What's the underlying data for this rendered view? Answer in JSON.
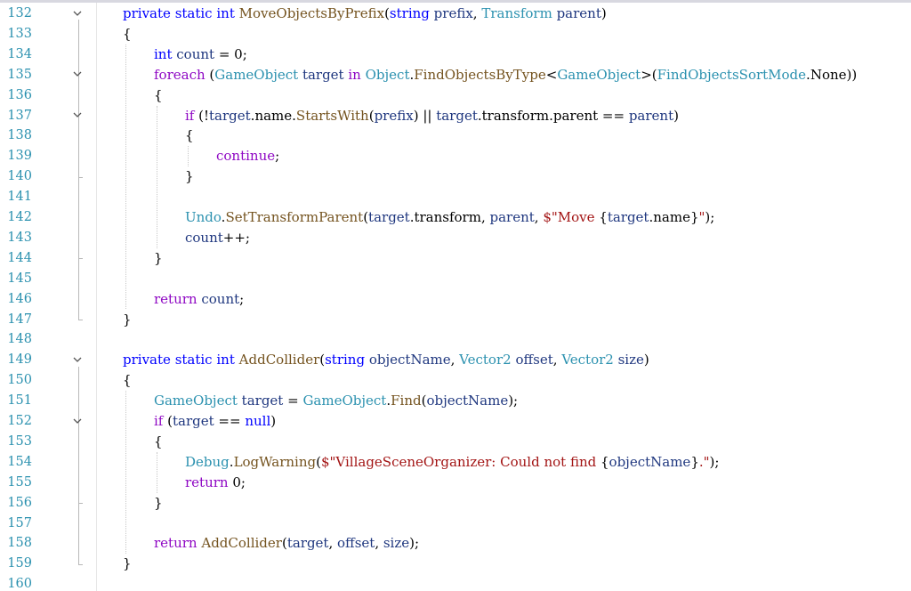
{
  "editor": {
    "lines": [
      {
        "n": "132",
        "fold": true,
        "indent": 0,
        "tokens": [
          [
            "kw",
            "private"
          ],
          [
            "pl",
            " "
          ],
          [
            "kw",
            "static"
          ],
          [
            "pl",
            " "
          ],
          [
            "kw",
            "int"
          ],
          [
            "pl",
            " "
          ],
          [
            "fn",
            "MoveObjectsByPrefix"
          ],
          [
            "pl",
            "("
          ],
          [
            "kw",
            "string"
          ],
          [
            "pl",
            " "
          ],
          [
            "pr",
            "prefix"
          ],
          [
            "pl",
            ", "
          ],
          [
            "ty",
            "Transform"
          ],
          [
            "pl",
            " "
          ],
          [
            "pr",
            "parent"
          ],
          [
            "pl",
            ")"
          ]
        ]
      },
      {
        "n": "133",
        "fold": false,
        "indent": 0,
        "tokens": [
          [
            "pl",
            "{"
          ]
        ]
      },
      {
        "n": "134",
        "fold": false,
        "indent": 1,
        "tokens": [
          [
            "kw",
            "int"
          ],
          [
            "pl",
            " "
          ],
          [
            "pr",
            "count"
          ],
          [
            "pl",
            " = 0;"
          ]
        ]
      },
      {
        "n": "135",
        "fold": true,
        "indent": 1,
        "tokens": [
          [
            "fl",
            "foreach"
          ],
          [
            "pl",
            " ("
          ],
          [
            "ty",
            "GameObject"
          ],
          [
            "pl",
            " "
          ],
          [
            "pr",
            "target"
          ],
          [
            "pl",
            " "
          ],
          [
            "fl",
            "in"
          ],
          [
            "pl",
            " "
          ],
          [
            "ty",
            "Object"
          ],
          [
            "pl",
            "."
          ],
          [
            "fn",
            "FindObjectsByType"
          ],
          [
            "pl",
            "<"
          ],
          [
            "ty",
            "GameObject"
          ],
          [
            "pl",
            ">("
          ],
          [
            "ty",
            "FindObjectsSortMode"
          ],
          [
            "pl",
            ".None))"
          ]
        ]
      },
      {
        "n": "136",
        "fold": false,
        "indent": 1,
        "tokens": [
          [
            "pl",
            "{"
          ]
        ]
      },
      {
        "n": "137",
        "fold": true,
        "indent": 2,
        "tokens": [
          [
            "fl",
            "if"
          ],
          [
            "pl",
            " (!"
          ],
          [
            "pr",
            "target"
          ],
          [
            "pl",
            ".name."
          ],
          [
            "fn",
            "StartsWith"
          ],
          [
            "pl",
            "("
          ],
          [
            "pr",
            "prefix"
          ],
          [
            "pl",
            ") || "
          ],
          [
            "pr",
            "target"
          ],
          [
            "pl",
            ".transform.parent == "
          ],
          [
            "pr",
            "parent"
          ],
          [
            "pl",
            ")"
          ]
        ]
      },
      {
        "n": "138",
        "fold": false,
        "indent": 2,
        "tokens": [
          [
            "pl",
            "{"
          ]
        ]
      },
      {
        "n": "139",
        "fold": false,
        "indent": 3,
        "tokens": [
          [
            "fl",
            "continue"
          ],
          [
            "pl",
            ";"
          ]
        ]
      },
      {
        "n": "140",
        "fold": false,
        "indent": 2,
        "tokens": [
          [
            "pl",
            "}"
          ]
        ]
      },
      {
        "n": "141",
        "fold": false,
        "indent": 2,
        "tokens": []
      },
      {
        "n": "142",
        "fold": false,
        "indent": 2,
        "tokens": [
          [
            "ty",
            "Undo"
          ],
          [
            "pl",
            "."
          ],
          [
            "fn",
            "SetTransformParent"
          ],
          [
            "pl",
            "("
          ],
          [
            "pr",
            "target"
          ],
          [
            "pl",
            ".transform, "
          ],
          [
            "pr",
            "parent"
          ],
          [
            "pl",
            ", "
          ],
          [
            "st",
            "$\"Move "
          ],
          [
            "pl",
            "{"
          ],
          [
            "pr",
            "target"
          ],
          [
            "pl",
            ".name}"
          ],
          [
            "st",
            "\""
          ],
          [
            "pl",
            ");"
          ]
        ]
      },
      {
        "n": "143",
        "fold": false,
        "indent": 2,
        "tokens": [
          [
            "pr",
            "count"
          ],
          [
            "pl",
            "++;"
          ]
        ]
      },
      {
        "n": "144",
        "fold": false,
        "indent": 1,
        "tokens": [
          [
            "pl",
            "}"
          ]
        ]
      },
      {
        "n": "145",
        "fold": false,
        "indent": 1,
        "tokens": []
      },
      {
        "n": "146",
        "fold": false,
        "indent": 1,
        "tokens": [
          [
            "fl",
            "return"
          ],
          [
            "pl",
            " "
          ],
          [
            "pr",
            "count"
          ],
          [
            "pl",
            ";"
          ]
        ]
      },
      {
        "n": "147",
        "fold": false,
        "indent": 0,
        "tokens": [
          [
            "pl",
            "}"
          ]
        ]
      },
      {
        "n": "148",
        "fold": false,
        "indent": 0,
        "tokens": []
      },
      {
        "n": "149",
        "fold": true,
        "indent": 0,
        "tokens": [
          [
            "kw",
            "private"
          ],
          [
            "pl",
            " "
          ],
          [
            "kw",
            "static"
          ],
          [
            "pl",
            " "
          ],
          [
            "kw",
            "int"
          ],
          [
            "pl",
            " "
          ],
          [
            "fn",
            "AddCollider"
          ],
          [
            "pl",
            "("
          ],
          [
            "kw",
            "string"
          ],
          [
            "pl",
            " "
          ],
          [
            "pr",
            "objectName"
          ],
          [
            "pl",
            ", "
          ],
          [
            "ty",
            "Vector2"
          ],
          [
            "pl",
            " "
          ],
          [
            "pr",
            "offset"
          ],
          [
            "pl",
            ", "
          ],
          [
            "ty",
            "Vector2"
          ],
          [
            "pl",
            " "
          ],
          [
            "pr",
            "size"
          ],
          [
            "pl",
            ")"
          ]
        ]
      },
      {
        "n": "150",
        "fold": false,
        "indent": 0,
        "tokens": [
          [
            "pl",
            "{"
          ]
        ]
      },
      {
        "n": "151",
        "fold": false,
        "indent": 1,
        "tokens": [
          [
            "ty",
            "GameObject"
          ],
          [
            "pl",
            " "
          ],
          [
            "pr",
            "target"
          ],
          [
            "pl",
            " = "
          ],
          [
            "ty",
            "GameObject"
          ],
          [
            "pl",
            "."
          ],
          [
            "fn",
            "Find"
          ],
          [
            "pl",
            "("
          ],
          [
            "pr",
            "objectName"
          ],
          [
            "pl",
            ");"
          ]
        ]
      },
      {
        "n": "152",
        "fold": true,
        "indent": 1,
        "tokens": [
          [
            "fl",
            "if"
          ],
          [
            "pl",
            " ("
          ],
          [
            "pr",
            "target"
          ],
          [
            "pl",
            " == "
          ],
          [
            "kw",
            "null"
          ],
          [
            "pl",
            ")"
          ]
        ]
      },
      {
        "n": "153",
        "fold": false,
        "indent": 1,
        "tokens": [
          [
            "pl",
            "{"
          ]
        ]
      },
      {
        "n": "154",
        "fold": false,
        "indent": 2,
        "tokens": [
          [
            "ty",
            "Debug"
          ],
          [
            "pl",
            "."
          ],
          [
            "fn",
            "LogWarning"
          ],
          [
            "pl",
            "("
          ],
          [
            "st",
            "$\"VillageSceneOrganizer: Could not find "
          ],
          [
            "pl",
            "{"
          ],
          [
            "pr",
            "objectName"
          ],
          [
            "pl",
            "}"
          ],
          [
            "st",
            ".\""
          ],
          [
            "pl",
            ");"
          ]
        ]
      },
      {
        "n": "155",
        "fold": false,
        "indent": 2,
        "tokens": [
          [
            "fl",
            "return"
          ],
          [
            "pl",
            " 0;"
          ]
        ]
      },
      {
        "n": "156",
        "fold": false,
        "indent": 1,
        "tokens": [
          [
            "pl",
            "}"
          ]
        ]
      },
      {
        "n": "157",
        "fold": false,
        "indent": 1,
        "tokens": []
      },
      {
        "n": "158",
        "fold": false,
        "indent": 1,
        "tokens": [
          [
            "fl",
            "return"
          ],
          [
            "pl",
            " "
          ],
          [
            "fn",
            "AddCollider"
          ],
          [
            "pl",
            "("
          ],
          [
            "pr",
            "target"
          ],
          [
            "pl",
            ", "
          ],
          [
            "pr",
            "offset"
          ],
          [
            "pl",
            ", "
          ],
          [
            "pr",
            "size"
          ],
          [
            "pl",
            ");"
          ]
        ]
      },
      {
        "n": "159",
        "fold": false,
        "indent": 0,
        "tokens": [
          [
            "pl",
            "}"
          ]
        ]
      },
      {
        "n": "160",
        "fold": false,
        "indent": 0,
        "tokens": []
      }
    ]
  },
  "colors": {
    "line_number": "#2b91af",
    "keyword": "#0000ff",
    "control_keyword": "#8f08c4",
    "type": "#2b91af",
    "method": "#74531f",
    "parameter": "#1f377f",
    "string": "#a31515",
    "background": "#ffffff"
  },
  "icons": {
    "fold_toggle": "chevron-down-icon"
  }
}
